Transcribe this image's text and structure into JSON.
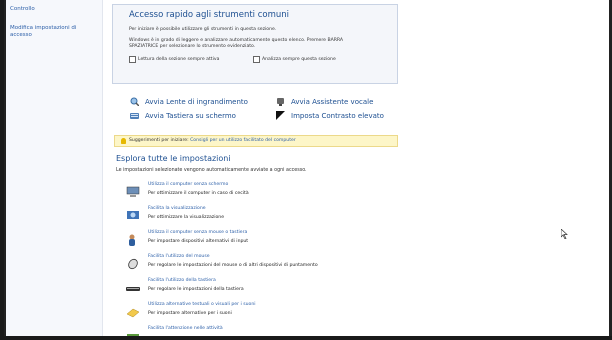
{
  "sidebar": {
    "items": [
      {
        "label": "Controllo"
      },
      {
        "label": "Modifica impostazioni di"
      },
      {
        "label": "accesso"
      }
    ]
  },
  "quick_access": {
    "title": "Accesso rapido agli strumenti comuni",
    "line1": "Per iniziare è possibile utilizzare gli strumenti in questa sezione.",
    "line2": "Windows è in grado di leggere e analizzare automaticamente questo elenco. Premere BARRA",
    "line3": "SPAZIATRICE per selezionare lo strumento evidenziato.",
    "check1": "Lettura della sezione sempre attiva",
    "check2": "Analizza sempre questa sezione"
  },
  "tools": [
    {
      "label": "Avvia Lente di ingrandimento",
      "icon": "magnifier-icon"
    },
    {
      "label": "Avvia Assistente vocale",
      "icon": "narrator-icon"
    },
    {
      "label": "Avvia Tastiera su schermo",
      "icon": "keyboard-icon"
    },
    {
      "label": "Imposta Contrasto elevato",
      "icon": "contrast-icon"
    }
  ],
  "suggestion": {
    "prefix": "Suggerimenti per iniziare:",
    "link": "Consigli per un utilizzo facilitato del computer"
  },
  "explore": {
    "title": "Esplora tutte le impostazioni",
    "subtitle": "Le impostazioni selezionate vengono automaticamente avviate a ogni accesso."
  },
  "settings": [
    {
      "link": "Utilizza il computer senza schermo",
      "desc": "Per ottimizzare il computer in caso di cecità",
      "icon": "computer-icon"
    },
    {
      "link": "Facilita la visualizzazione",
      "desc": "Per ottimizzare la visualizzazione",
      "icon": "display-icon"
    },
    {
      "link": "Utilizza il computer senza mouse o tastiera",
      "desc": "Per impostare dispositivi alternativi di input",
      "icon": "person-icon"
    },
    {
      "link": "Facilita l'utilizzo del mouse",
      "desc": "Per regolare le impostazioni del mouse o di altri dispositivi di puntamento",
      "icon": "mouse-icon"
    },
    {
      "link": "Facilita l'utilizzo della tastiera",
      "desc": "Per regolare le impostazioni della tastiera",
      "icon": "keyboard-setting-icon"
    },
    {
      "link": "Utilizza alternative testuali o visuali per i suoni",
      "desc": "Per impostare alternative per i suoni",
      "icon": "sound-alternative-icon"
    },
    {
      "link": "Facilita l'attenzione nelle attività",
      "desc": "",
      "icon": "focus-icon"
    }
  ],
  "colors": {
    "link": "#2c5fa8",
    "heading": "#1d4f91",
    "suggest_bg": "#fdf6c8"
  }
}
